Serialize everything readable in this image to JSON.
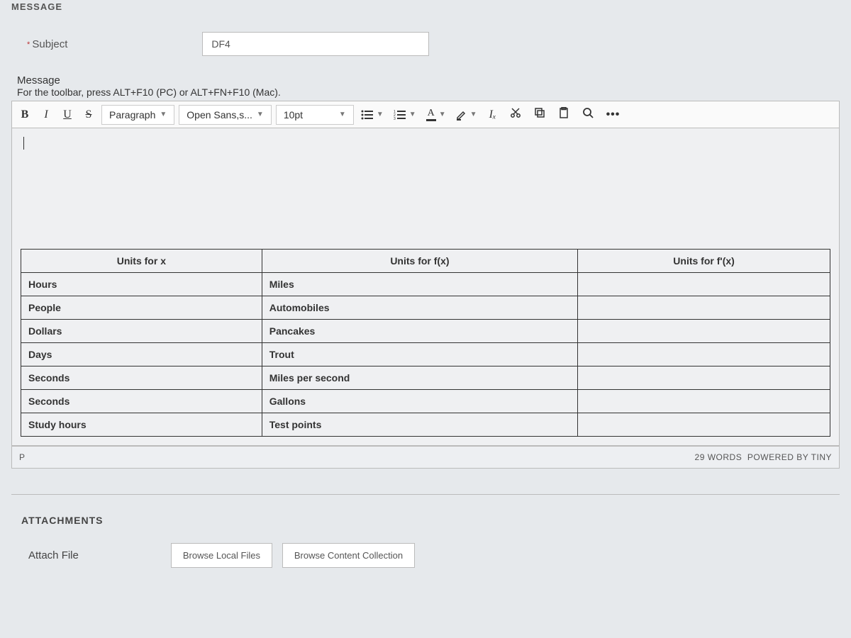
{
  "header": {
    "message_section": "MESSAGE"
  },
  "subject": {
    "label": "Subject",
    "value": "DF4"
  },
  "message": {
    "label": "Message",
    "hint": "For the toolbar, press ALT+F10 (PC) or ALT+FN+F10 (Mac).",
    "toolbar": {
      "bold": "B",
      "italic": "I",
      "underline": "U",
      "strike": "S",
      "block_format": "Paragraph",
      "font_family": "Open Sans,s...",
      "font_size": "10pt",
      "font_color": "A",
      "clear_format": "Iₓ"
    },
    "table": {
      "headers": [
        "Units for x",
        "Units for f(x)",
        "Units for f'(x)"
      ],
      "rows": [
        [
          "Hours",
          "Miles",
          ""
        ],
        [
          "People",
          "Automobiles",
          ""
        ],
        [
          "Dollars",
          "Pancakes",
          ""
        ],
        [
          "Days",
          "Trout",
          ""
        ],
        [
          "Seconds",
          "Miles per second",
          ""
        ],
        [
          "Seconds",
          "Gallons",
          ""
        ],
        [
          "Study hours",
          "Test points",
          ""
        ]
      ]
    },
    "status": {
      "path": "P",
      "words": "29 WORDS",
      "powered": "POWERED BY TINY"
    }
  },
  "attachments": {
    "section": "ATTACHMENTS",
    "label": "Attach File",
    "browse_local": "Browse Local Files",
    "browse_collection": "Browse Content Collection"
  }
}
